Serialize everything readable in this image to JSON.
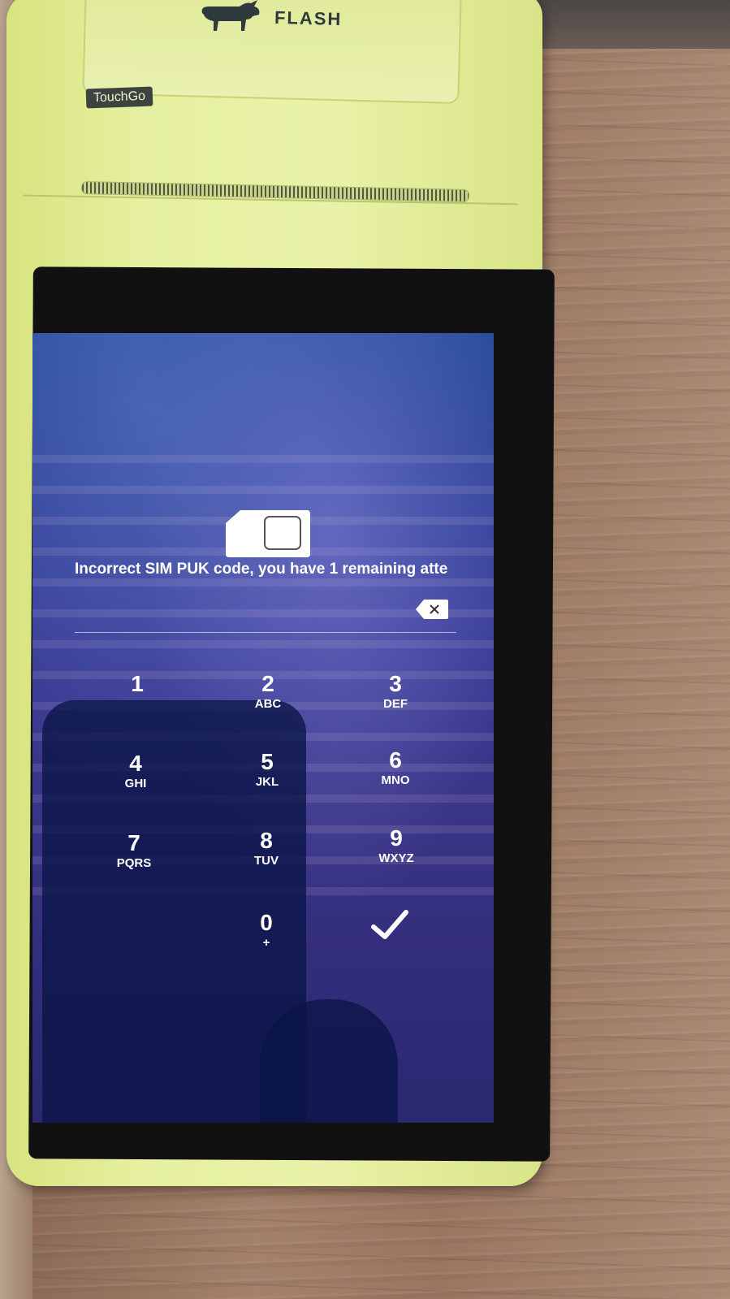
{
  "device": {
    "brand": "FLASH",
    "model": "TouchGo"
  },
  "lock_screen": {
    "sim_icon": "sim-card-icon",
    "message": "Incorrect SIM PUK code, you have 1 remaining atte",
    "backspace_icon": "backspace-icon",
    "confirm_icon": "checkmark-icon",
    "keys": [
      {
        "digit": "1",
        "letters": ""
      },
      {
        "digit": "2",
        "letters": "ABC"
      },
      {
        "digit": "3",
        "letters": "DEF"
      },
      {
        "digit": "4",
        "letters": "GHI"
      },
      {
        "digit": "5",
        "letters": "JKL"
      },
      {
        "digit": "6",
        "letters": "MNO"
      },
      {
        "digit": "7",
        "letters": "PQRS"
      },
      {
        "digit": "8",
        "letters": "TUV"
      },
      {
        "digit": "9",
        "letters": "WXYZ"
      },
      {
        "digit": "0",
        "letters": "+"
      }
    ]
  },
  "colors": {
    "device_body": "#e6f0a0",
    "screen_top": "#2b4d9e",
    "screen_bottom": "#2b2770",
    "text": "#ffffff"
  }
}
